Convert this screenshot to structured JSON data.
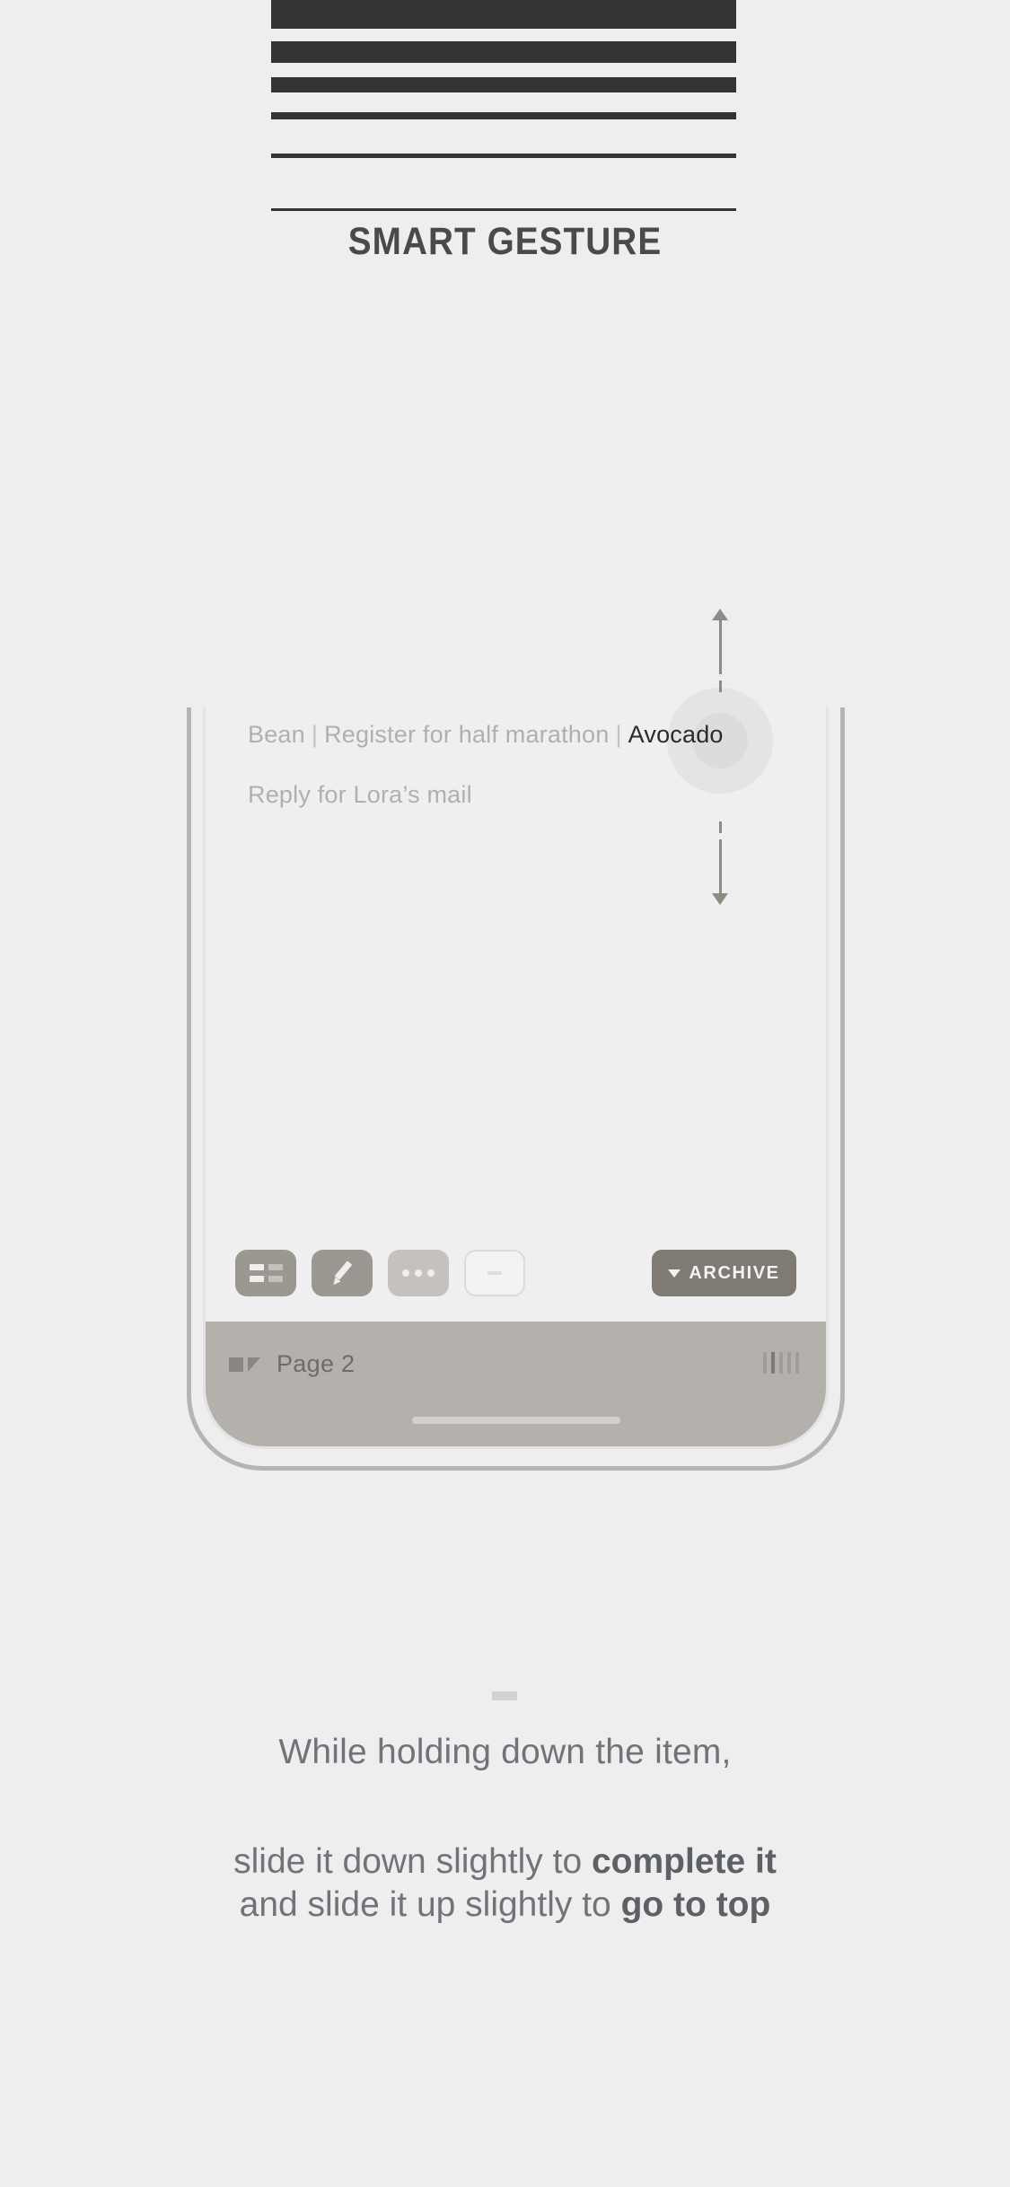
{
  "header": {
    "title": "SMART GESTURE",
    "deco_lines": [
      {
        "height": 32,
        "gap": 14
      },
      {
        "height": 24,
        "gap": 16
      },
      {
        "height": 17,
        "gap": 22
      },
      {
        "height": 8,
        "gap": 38
      },
      {
        "height": 5,
        "gap": 56
      },
      {
        "height": 3,
        "gap": 0
      }
    ]
  },
  "phone": {
    "list": {
      "row1": {
        "item1": "Bean",
        "sep1": "|",
        "item2": "Register for half marathon",
        "sep2": "|",
        "item3_active": "Avocado"
      },
      "row2": "Reply for Lora’s mail"
    },
    "gesture": {
      "up_arrow": "arrow-up-icon",
      "down_arrow": "arrow-down-icon",
      "dragged_item": "Avocado"
    },
    "toolbar": {
      "list_icon": "list-grid-icon",
      "edit_icon": "pencil-icon",
      "more_icon": "ellipsis-icon",
      "blank_icon": "dash-icon",
      "archive_label": "ARCHIVE",
      "archive_caret": "caret-down-icon"
    },
    "bottombar": {
      "page_icon": "square-triangle-icon",
      "page_label": "Page 2",
      "signal_icon": "signal-bars-icon",
      "signal_bars": 5,
      "signal_active_index": 1,
      "home_indicator": "home-indicator"
    }
  },
  "caption": {
    "divider": "caption-divider",
    "line1": "While holding down the item,",
    "line2_a": "slide it down slightly to ",
    "line2_b": "complete it",
    "line3_a": "and slide it up slightly to ",
    "line3_b": "go to top"
  },
  "colors": {
    "background": "#eeeeee",
    "deco_line": "#333333",
    "title": "#4a4a4a",
    "phone_frame": "#b4b4b4",
    "phone_screen": "#efefef",
    "list_text": "#b0b0b0",
    "active_text": "#2b2b2b",
    "halo_outer": "#e4e4e4",
    "halo_inner": "#dcdcdc",
    "arrow": "#8f8a84",
    "btn_dark": "#9b9791",
    "btn_light": "#c5c2bd",
    "btn_archive": "#7f7a73",
    "bottombar": "#b4b0ab",
    "caption_text": "#70747a"
  }
}
